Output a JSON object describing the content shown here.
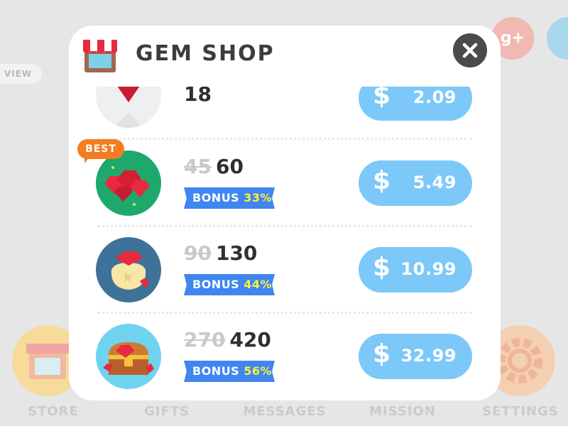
{
  "background": {
    "view_label": "VIEW",
    "gplus_label": "g+",
    "nav": [
      {
        "label": "STORE",
        "icon": "store-icon",
        "color": "#f7d98f"
      },
      {
        "label": "GIFTS",
        "icon": "gift-icon",
        "color": "#e6e6e6"
      },
      {
        "label": "MESSAGES",
        "icon": "message-icon",
        "color": "#e6e6e6"
      },
      {
        "label": "MISSION",
        "icon": "mission-icon",
        "color": "#e6e6e6"
      },
      {
        "label": "SETTINGS",
        "icon": "gear-icon",
        "color": "#f3c9a8"
      }
    ]
  },
  "modal": {
    "title": "GEM SHOP",
    "icon": "shop-awning-icon",
    "close_icon": "close-icon",
    "items": [
      {
        "old_qty": "",
        "qty": "18",
        "bonus_label": "",
        "bonus_pct": "",
        "price_symbol": "$",
        "price": "2.09",
        "icon": "single-gem-icon",
        "icon_bg": "#efefef"
      },
      {
        "old_qty": "45",
        "qty": "60",
        "bonus_label": "BONUS",
        "bonus_pct": "33%",
        "price_symbol": "$",
        "price": "5.49",
        "icon": "gem-pile-icon",
        "icon_bg": "#1ea86b",
        "badge": "BEST"
      },
      {
        "old_qty": "90",
        "qty": "130",
        "bonus_label": "BONUS",
        "bonus_pct": "44%",
        "price_symbol": "$",
        "price": "10.99",
        "icon": "gem-bag-icon",
        "icon_bg": "#3d7299"
      },
      {
        "old_qty": "270",
        "qty": "420",
        "bonus_label": "BONUS",
        "bonus_pct": "56%",
        "price_symbol": "$",
        "price": "32.99",
        "icon": "treasure-chest-icon",
        "icon_bg": "#6fd3ef"
      }
    ]
  },
  "colors": {
    "price_button": "#7cc8f8",
    "bonus_ribbon": "#3f86f1",
    "bonus_highlight": "#fff23a",
    "best_badge": "#f57c1f",
    "gem_red": "#e8293f"
  }
}
